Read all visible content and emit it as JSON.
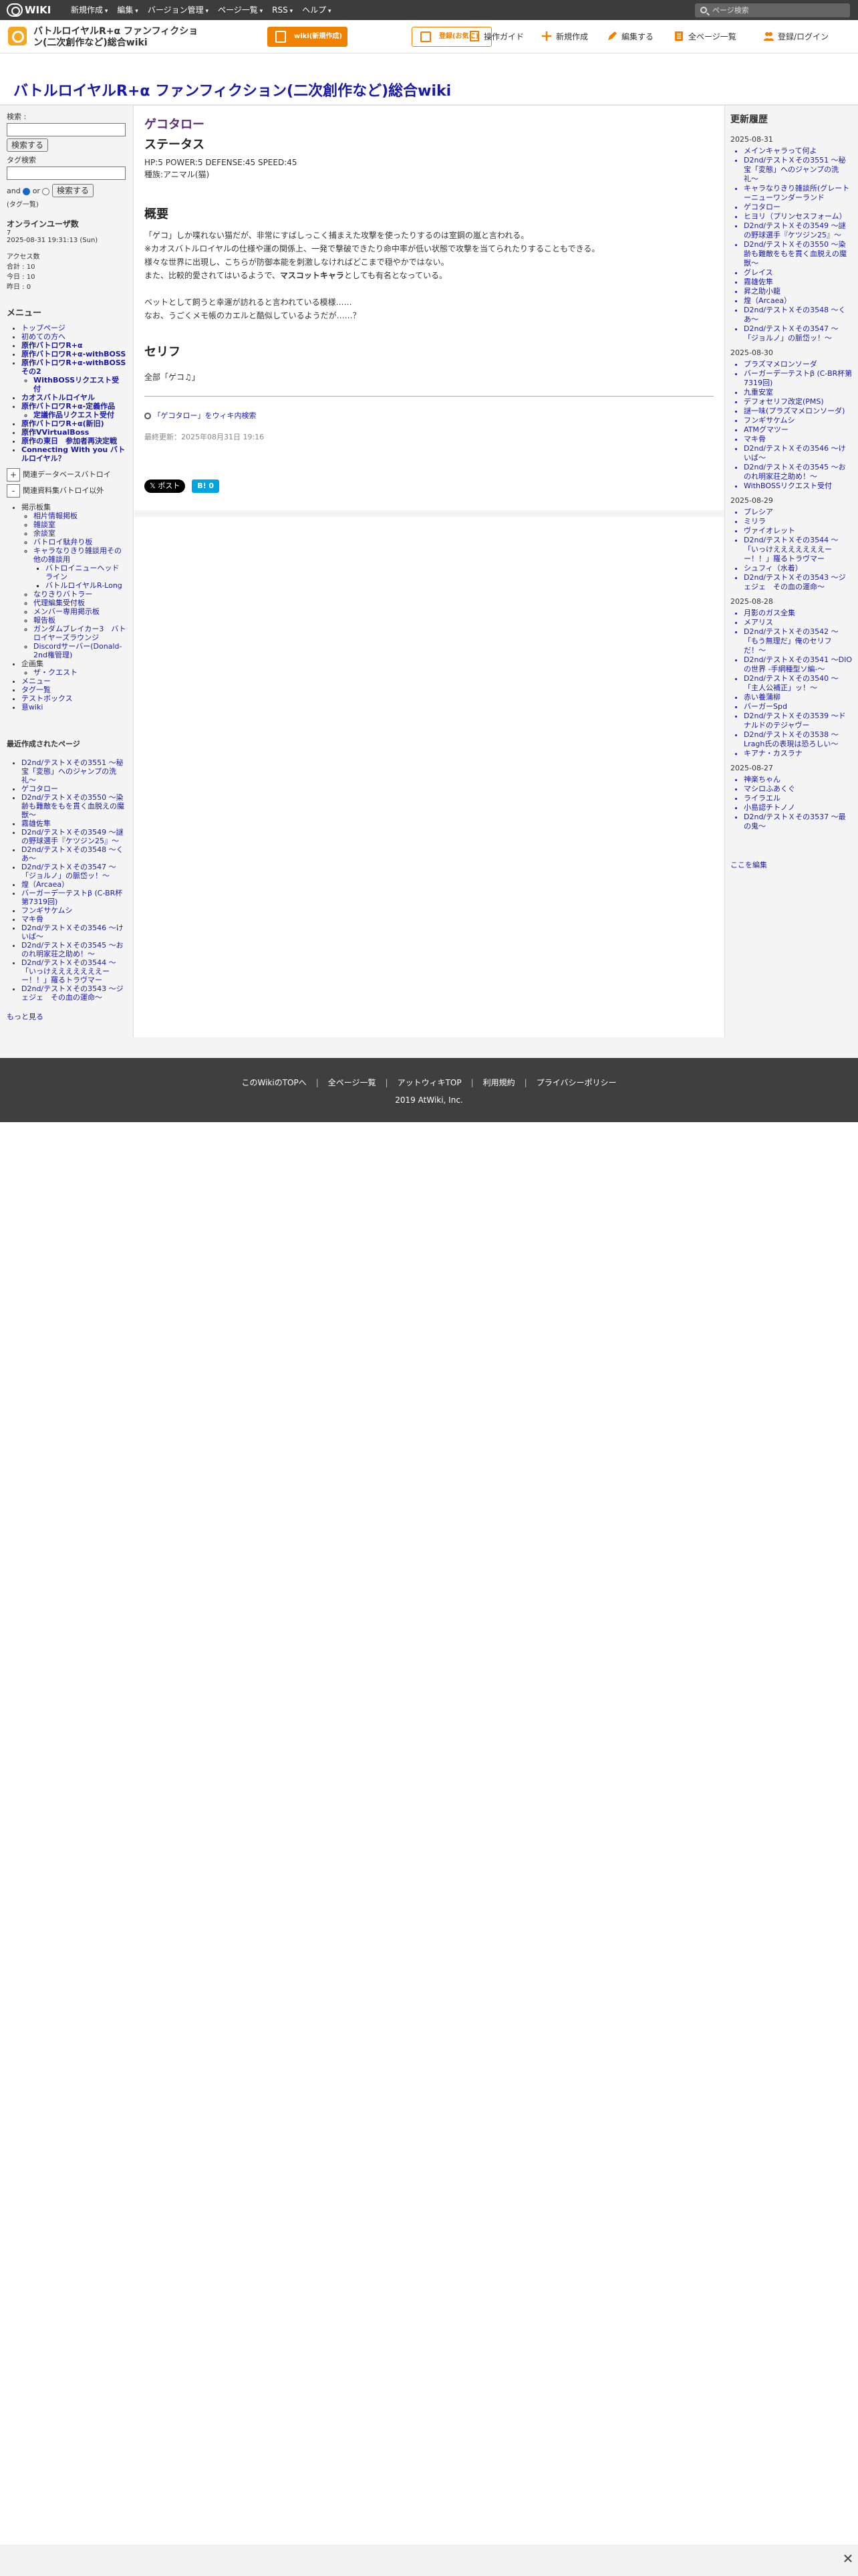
{
  "topbar": {
    "logo": "WIKI",
    "menus": [
      "新規作成",
      "編集",
      "バージョン管理",
      "ページ一覧",
      "RSS",
      "ヘルプ"
    ],
    "search_placeholder": "ページ検索"
  },
  "header": {
    "wiki_title": "バトルロイヤルR+α ファンフィクション(二次創作など)総合wiki",
    "btn_signup": "wiki(新規作成)",
    "btn_shortcut": "登録(お気に)",
    "tools": [
      "操作ガイド",
      "新規作成",
      "編集する",
      "全ページ一覧",
      "登録/ログイン"
    ]
  },
  "page_title": "バトルロイヤルR+α ファンフィクション(二次創作など)総合wiki",
  "left": {
    "search_label": "検索 :",
    "search_button": "検索する",
    "tag_label": "タグ検索",
    "tag_and": "and",
    "tag_or": "or",
    "tag_button": "検索する",
    "tag_link": "(タグ一覧)",
    "online_title": "オンラインユーザ数",
    "online_count": "7",
    "datetime": "2025-08-31 19:31:13 (Sun)",
    "access_title": "アクセス数",
    "access_total": "合計 : 10",
    "access_today": "今日 : 10",
    "access_yesterday": "昨日 : 0",
    "menu_title": "メニュー",
    "menu": [
      {
        "label": "トップページ",
        "bold": false
      },
      {
        "label": "初めての方へ",
        "bold": false
      },
      {
        "label": "原作バトロワR+α",
        "bold": true
      },
      {
        "label": "原作バトロワR+α-withBOSS",
        "bold": true
      },
      {
        "label": "原作バトロワR+α-withBOSSその2",
        "bold": true
      },
      {
        "label": "WithBOSSリクエスト受付",
        "bold": false,
        "sub": true
      },
      {
        "label": "カオスバトルロイヤル",
        "bold": true
      },
      {
        "label": "原作バトロワR+α-定義作品",
        "bold": true
      },
      {
        "label": "定議作品リクエスト受付",
        "bold": false,
        "sub": true
      },
      {
        "label": "原作バトロワR+α(新旧)",
        "bold": true
      },
      {
        "label": "原作VVirtualBoss",
        "bold": true
      },
      {
        "label": "原作の東日　参加者再決定戦",
        "bold": true
      },
      {
        "label": "Connecting With you バトルロイヤル？",
        "bold": true
      }
    ],
    "toggle1": "関連データベースバトロイ",
    "toggle2": "関連資料集バトロイ以外",
    "tree": [
      {
        "label": "掲示板集",
        "level": 1,
        "link": false
      },
      {
        "label": "相片情報掲板",
        "level": 2
      },
      {
        "label": "雑談室",
        "level": 2
      },
      {
        "label": "余談室",
        "level": 2
      },
      {
        "label": "バトロイ駄弁り板",
        "level": 2
      },
      {
        "label": "キャラなりきり雑談用その他の雑談用",
        "level": 2
      },
      {
        "label": "バトロイニューヘッドライン",
        "level": 3
      },
      {
        "label": "バトルロイヤルR-Long",
        "level": 3
      },
      {
        "label": "なりきりバトラー",
        "level": 2
      },
      {
        "label": "代理編集受付板",
        "level": 2
      },
      {
        "label": "メンバー専用掲示板",
        "level": 2
      },
      {
        "label": "報告板",
        "level": 2
      },
      {
        "label": "ガンダムブレイカー3　バトロイヤーズラウンジ",
        "level": 2
      },
      {
        "label": "Discordサーバー(Donald-2nd権管理)",
        "level": 2
      },
      {
        "label": "企画集",
        "level": 1,
        "link": false
      },
      {
        "label": "ザ・クエスト",
        "level": 2
      },
      {
        "label": "メニュー",
        "level": 1
      },
      {
        "label": "タグ一覧",
        "level": 1
      },
      {
        "label": "テストボックス",
        "level": 1
      },
      {
        "label": "意wiki",
        "level": 1
      }
    ],
    "recent_title": "最近作成されたページ",
    "recent": [
      "D2nd/テストＸその3551 〜秘宝「変態」へのジャンプの洗礼〜",
      "ゲコタロー",
      "D2nd/テストＸその3550 〜染齢も難敵をもを貫く血脱えの魔獣〜",
      "霧雄佐隼",
      "D2nd/テストＸその3549 〜謎の野球選手『ケツジン25』〜",
      "D2nd/テストＸその3548 〜くあ〜",
      "D2nd/テストＸその3547 〜「ジョルノ」の脈岱ッ！〜",
      "煌（Arcaea）",
      "バーガーデ一テストβ (C-BR杯第7319回)",
      "フンギサケムシ",
      "マキ骨",
      "D2nd/テストＸその3546 〜けいば〜",
      "D2nd/テストＸその3545 〜おのれ明家荘之助め！〜",
      "D2nd/テストＸその3544 〜「いっけえええええええーー！！」羅るトラヴマー",
      "D2nd/テストＸその3543 〜ジェジェ　その血の運命〜"
    ],
    "more": "もっと見る"
  },
  "main": {
    "page_name": "ゲコタロー",
    "status_heading": "ステータス",
    "status_line1": "HP:5 POWER:5 DEFENSE:45 SPEED:45",
    "status_line2": "種族:アニマル(猫)",
    "overview_heading": "概要",
    "overview_lines": [
      "「ゲコ」しか喋れない猫だが、非常にすばしっこく捕まえた攻撃を使ったりするのは室鋼の嵐と言われる。",
      "※カオスバトルロイヤルの仕様や運の関係上、一発で撃破できたり命中率が低い状態で攻撃を当てられたりすることもできる。",
      "様々な世界に出現し、こちらが防御本能を刺激しなければどこまで穏やかではない。",
      "また、比較的愛されてはいるようで、"
    ],
    "overview_bold": "マスコットキャラ",
    "overview_tail": "としても有名となっている。",
    "overview_lines2": [
      "ベットとして飼うと幸運が訪れると言われている模様……",
      "なお、うごくメモ帳のカエルと酷似しているようだが……？"
    ],
    "serif_heading": "セリフ",
    "serif_text": "全部「ゲコ♫」",
    "wiki_search_link": "「ゲコタロー」をウィキ内検索",
    "last_updated": "最終更新：2025年08月31日 19:16",
    "btn_post": "ポスト",
    "btn_hatena": "B!"
  },
  "right": {
    "title": "更新履歴",
    "groups": [
      {
        "date": "2025-08-31",
        "items": [
          "メインキャラって何よ",
          "D2nd/テストＸその3551 〜秘宝「変態」へのジャンプの洗礼〜",
          "キャラなりきり雑談所(グレートーニューワンダーランド",
          "ゲコタロー",
          "ヒヨリ（プリンセスフォーム）",
          "D2nd/テストＸその3549 〜謎の野球選手『ケツジン25』〜",
          "D2nd/テストＸその3550 〜染齢も難敵をもを貫く血脱えの魔獣〜",
          "グレイス",
          "霧雄佐隼",
          "昇之助小龍",
          "煌（Arcaea）",
          "D2nd/テストＸその3548 〜くあ〜",
          "D2nd/テストＸその3547 〜「ジョルノ」の脈岱ッ！〜"
        ]
      },
      {
        "date": "2025-08-30",
        "items": [
          "プラズマメロンソーダ",
          "バーガーデ一テストβ (C-BR杯第7319回)",
          "九重安室",
          "デフォセリフ改定(PMS)",
          "謎一味(プラズマメロンソーダ)",
          "フンギサケムシ",
          "ATMグマツー",
          "マキ骨",
          "D2nd/テストＸその3546 〜けいば〜",
          "D2nd/テストＸその3545 〜おのれ明家荘之助め！〜",
          "WithBOSSリクエスト受付"
        ]
      },
      {
        "date": "2025-08-29",
        "items": [
          "プレシア",
          "ミリラ",
          "ヴァイオレット",
          "D2nd/テストＸその3544 〜「いっけえええええええーー！！」羅るトラヴマー",
          "シュフィ（水着）",
          "D2nd/テストＸその3543 〜ジェジェ　その血の運命〜"
        ]
      },
      {
        "date": "2025-08-28",
        "items": [
          "月影のガス全集",
          "メアリス",
          "D2nd/テストＸその3542 〜「もう無理だ」俺のセリフだ！〜",
          "D2nd/テストＸその3541 〜DIOの世界 -手網種型ソ編-〜",
          "D2nd/テストＸその3540 〜「主人公補正」ッ！〜",
          "赤い養蒲柳",
          "バーガーSpd",
          "D2nd/テストＸその3539 〜ドナルドのテジャヴー",
          "D2nd/テストＸその3538 〜Lragh氏の表現は恐ろしい〜",
          "キアナ・カスラナ"
        ]
      },
      {
        "date": "2025-08-27",
        "items": [
          "神楽ちゃん",
          "マシロふあくぐ",
          "ライラエル",
          "小島認チトノノ",
          "D2nd/テストＸその3537 〜最の鬼〜"
        ]
      }
    ],
    "edit_link": "ここを編集"
  },
  "footer": {
    "links": [
      "このWikiのTOPへ",
      "全ページ一覧",
      "アットウィキTOP",
      "利用規約",
      "プライバシーポリシー"
    ],
    "copyright": "2019 AtWiki, Inc."
  }
}
